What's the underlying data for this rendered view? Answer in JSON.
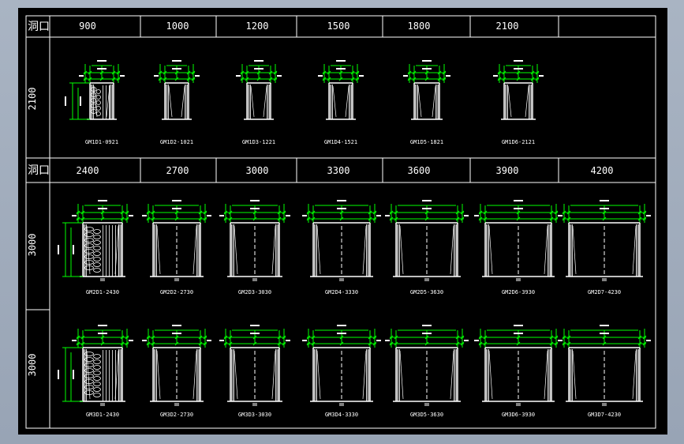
{
  "colors": {
    "line": "#ffffff",
    "dim": "#00ff00",
    "background": "#000000",
    "frame": "#a9b4c3"
  },
  "table": {
    "header_label": "洞口",
    "section1": {
      "widths": [
        "900",
        "1000",
        "1200",
        "1500",
        "1800",
        "2100"
      ],
      "row_heights": [
        "2100"
      ],
      "codes": [
        [
          "GM1D1-0921",
          "GM1D2-1021",
          "GM1D3-1221",
          "GM1D4-1521",
          "GM1D5-1821",
          "GM1D6-2121"
        ]
      ]
    },
    "section2": {
      "widths": [
        "2400",
        "2700",
        "3000",
        "3300",
        "3600",
        "3900",
        "4200"
      ],
      "row_heights": [
        "3000",
        "3000"
      ],
      "codes": [
        [
          "GM2D1-2430",
          "GM2D2-2730",
          "GM2D3-3030",
          "GM2D4-3330",
          "GM2D5-3630",
          "GM2D6-3930",
          "GM2D7-4230"
        ],
        [
          "GM3D1-2430",
          "GM3D2-2730",
          "GM3D3-3030",
          "GM3D4-3330",
          "GM3D5-3630",
          "GM3D6-3930",
          "GM3D7-4230"
        ]
      ]
    }
  }
}
